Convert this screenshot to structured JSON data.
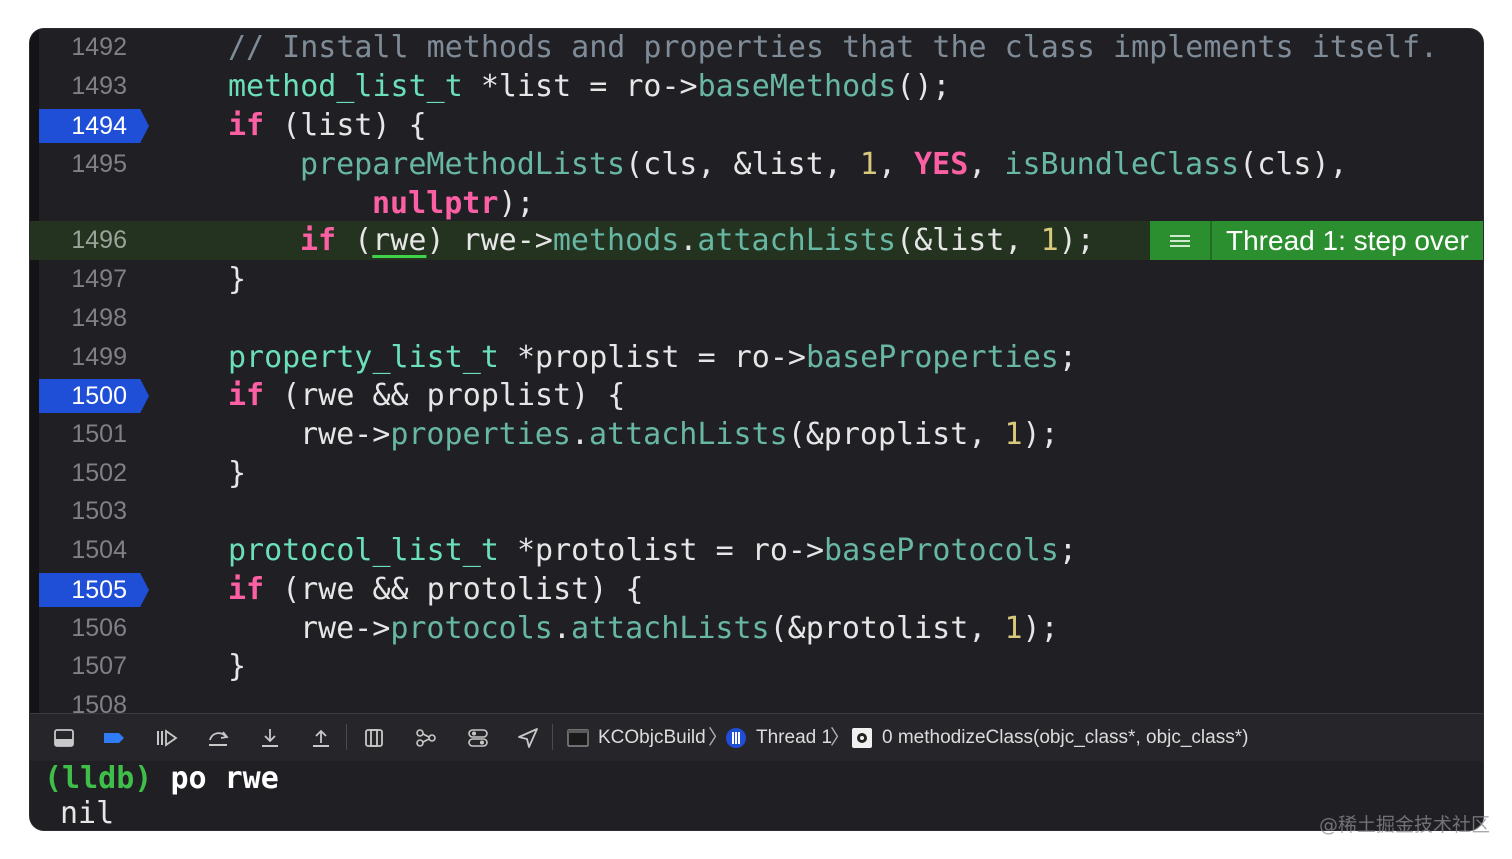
{
  "editor": {
    "lines": [
      {
        "num": "1492",
        "tokens": [
          {
            "t": "// Install methods and properties that the class implements itself.",
            "c": "comment"
          }
        ]
      },
      {
        "num": "1493",
        "tokens": [
          {
            "t": "method_list_t",
            "c": "type"
          },
          {
            "t": " *list = ro->",
            "c": "plain"
          },
          {
            "t": "baseMethods",
            "c": "fn"
          },
          {
            "t": "();",
            "c": "plain"
          }
        ]
      },
      {
        "num": "1494",
        "breakpoint": true,
        "tokens": [
          {
            "t": "if",
            "c": "kw"
          },
          {
            "t": " (list) {",
            "c": "plain"
          }
        ]
      },
      {
        "num": "1495",
        "tokens": [
          {
            "t": "prepareMethodLists",
            "c": "fn"
          },
          {
            "t": "(cls, &list, ",
            "c": "plain"
          },
          {
            "t": "1",
            "c": "num"
          },
          {
            "t": ", ",
            "c": "plain"
          },
          {
            "t": "YES",
            "c": "kw"
          },
          {
            "t": ", ",
            "c": "plain"
          },
          {
            "t": "isBundleClass",
            "c": "fn"
          },
          {
            "t": "(cls),",
            "c": "plain"
          }
        ]
      },
      {
        "num": "",
        "tokens": [
          {
            "t": "nullptr",
            "c": "kw"
          },
          {
            "t": ");",
            "c": "plain"
          }
        ]
      },
      {
        "num": "1496",
        "current": true,
        "tokens": [
          {
            "t": "if",
            "c": "kw"
          },
          {
            "t": " (",
            "c": "plain"
          },
          {
            "t": "rwe",
            "c": "var"
          },
          {
            "t": ") rwe->",
            "c": "plain"
          },
          {
            "t": "methods",
            "c": "fn"
          },
          {
            "t": ".",
            "c": "plain"
          },
          {
            "t": "attachLists",
            "c": "fn"
          },
          {
            "t": "(&list, ",
            "c": "plain"
          },
          {
            "t": "1",
            "c": "num"
          },
          {
            "t": ");",
            "c": "plain"
          }
        ]
      },
      {
        "num": "1497",
        "tokens": [
          {
            "t": "}",
            "c": "plain"
          }
        ]
      },
      {
        "num": "1498",
        "tokens": []
      },
      {
        "num": "1499",
        "tokens": [
          {
            "t": "property_list_t",
            "c": "type"
          },
          {
            "t": " *proplist = ro->",
            "c": "plain"
          },
          {
            "t": "baseProperties",
            "c": "fn"
          },
          {
            "t": ";",
            "c": "plain"
          }
        ]
      },
      {
        "num": "1500",
        "breakpoint": true,
        "tokens": [
          {
            "t": "if",
            "c": "kw"
          },
          {
            "t": " (rwe && proplist) {",
            "c": "plain"
          }
        ]
      },
      {
        "num": "1501",
        "tokens": [
          {
            "t": "rwe->",
            "c": "plain"
          },
          {
            "t": "properties",
            "c": "fn"
          },
          {
            "t": ".",
            "c": "plain"
          },
          {
            "t": "attachLists",
            "c": "fn"
          },
          {
            "t": "(&proplist, ",
            "c": "plain"
          },
          {
            "t": "1",
            "c": "num"
          },
          {
            "t": ");",
            "c": "plain"
          }
        ]
      },
      {
        "num": "1502",
        "tokens": [
          {
            "t": "}",
            "c": "plain"
          }
        ]
      },
      {
        "num": "1503",
        "tokens": []
      },
      {
        "num": "1504",
        "tokens": [
          {
            "t": "protocol_list_t",
            "c": "type"
          },
          {
            "t": " *protolist = ro->",
            "c": "plain"
          },
          {
            "t": "baseProtocols",
            "c": "fn"
          },
          {
            "t": ";",
            "c": "plain"
          }
        ]
      },
      {
        "num": "1505",
        "breakpoint": true,
        "tokens": [
          {
            "t": "if",
            "c": "kw"
          },
          {
            "t": " (rwe && protolist) {",
            "c": "plain"
          }
        ]
      },
      {
        "num": "1506",
        "tokens": [
          {
            "t": "rwe->",
            "c": "plain"
          },
          {
            "t": "protocols",
            "c": "fn"
          },
          {
            "t": ".",
            "c": "plain"
          },
          {
            "t": "attachLists",
            "c": "fn"
          },
          {
            "t": "(&protolist, ",
            "c": "plain"
          },
          {
            "t": "1",
            "c": "num"
          },
          {
            "t": ");",
            "c": "plain"
          }
        ]
      },
      {
        "num": "1507",
        "tokens": [
          {
            "t": "}",
            "c": "plain"
          }
        ]
      },
      {
        "num": "1508",
        "tokens": []
      }
    ],
    "thread_badge": "Thread 1: step over"
  },
  "debugbar": {
    "target": "KCObjcBuild",
    "thread": "Thread 1",
    "frame": "0 methodizeClass(objc_class*, objc_class*)"
  },
  "console": {
    "prompt": "(lldb)",
    "command": "po rwe",
    "output": "nil"
  },
  "watermark": "@稀土掘金技术社区",
  "colors": {
    "breakpoint": "#1f4fd6",
    "current_line": "#23331f",
    "thread_badge": "#2c8f2f",
    "keyword": "#fc5fa3",
    "type": "#6bdfb8",
    "function": "#67b7a4",
    "number": "#d9c97c",
    "comment": "#7f8c98"
  }
}
